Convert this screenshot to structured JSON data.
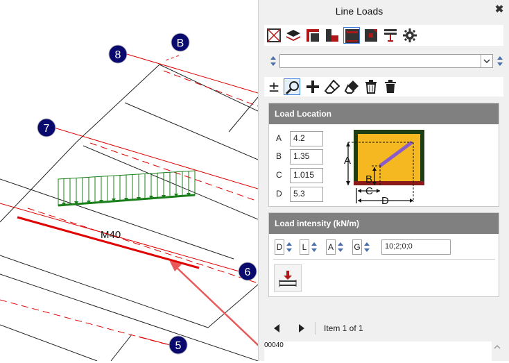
{
  "panel": {
    "title": "Line Loads",
    "toolbar_icons": [
      "element-grid-icon",
      "layers-icon",
      "beam-section-icon",
      "l-shape-icon",
      "slab-load-icon",
      "column-load-icon",
      "wall-load-icon",
      "settings-gear-icon"
    ],
    "edit_icons": [
      "plus-minus-icon",
      "zoom-icon",
      "add-icon",
      "eraser-icon",
      "eraser-fill-icon",
      "trash-icon",
      "trash-fill-icon"
    ],
    "load_location": {
      "header": "Load Location",
      "fields": [
        {
          "label": "A",
          "value": "4.2"
        },
        {
          "label": "B",
          "value": "1.35"
        },
        {
          "label": "C",
          "value": "1.015"
        },
        {
          "label": "D",
          "value": "5.3"
        }
      ],
      "diagram_labels": {
        "a": "A",
        "b": "B",
        "c": "C",
        "d": "D"
      }
    },
    "load_intensity": {
      "header": "Load intensity (kN/m)",
      "selectors": [
        "D",
        "L",
        "A",
        "G"
      ],
      "value": "10;2;0;0"
    },
    "navigation": {
      "item_text": "Item 1 of 1"
    },
    "code": "00040"
  },
  "canvas": {
    "grid_labels": [
      "8",
      "B",
      "7",
      "6",
      "5"
    ],
    "member_label": "M40"
  },
  "colors": {
    "grid_bubble": "#0a0a6e",
    "load_green": "#1a7f1a",
    "member_red": "#e00000",
    "panel_header": "#808080"
  }
}
